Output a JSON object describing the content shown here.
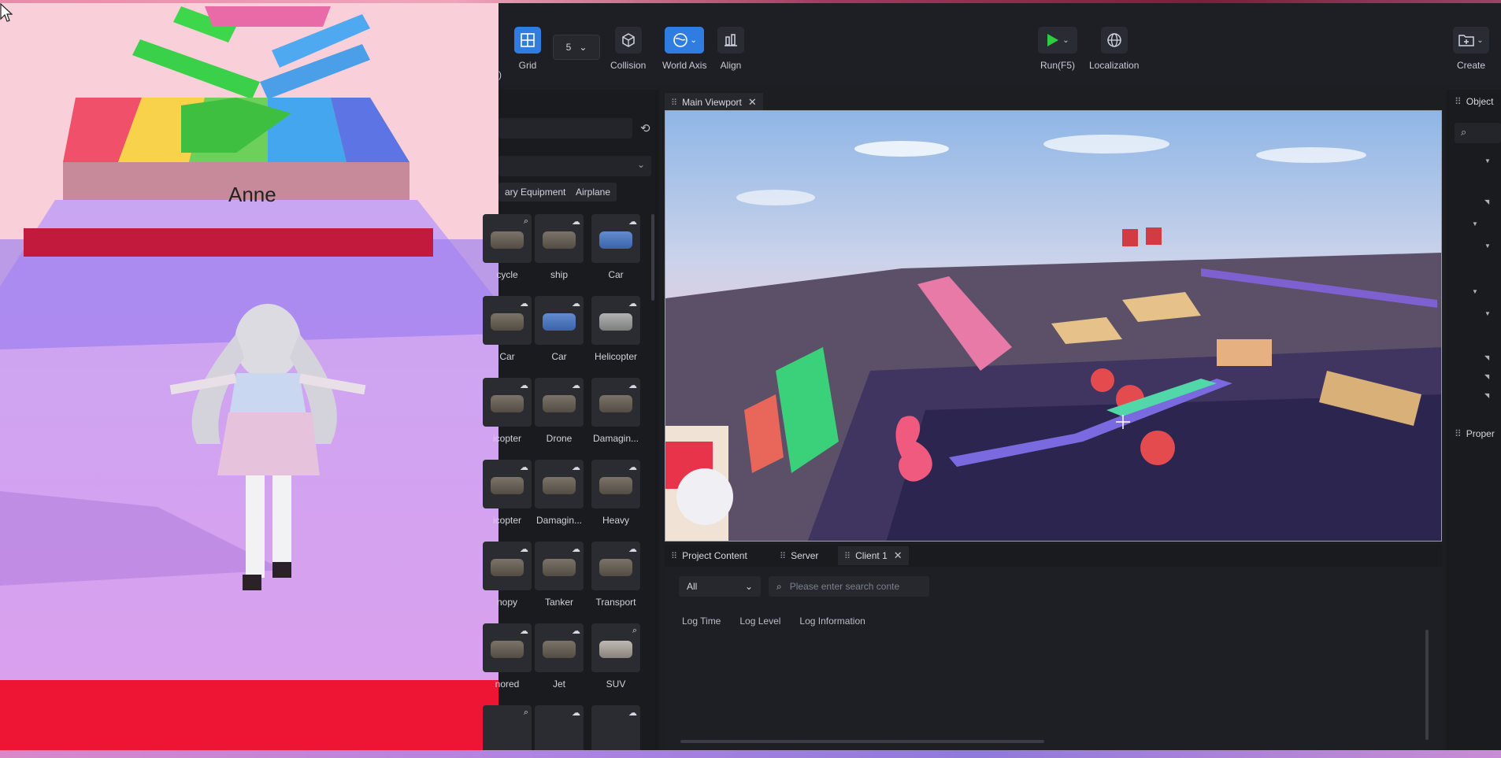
{
  "game": {
    "player_name": "Anne"
  },
  "toolbar": {
    "left_fragment": ")",
    "grid": {
      "label": "Grid"
    },
    "grid_size": {
      "value": "5"
    },
    "collision": {
      "label": "Collision"
    },
    "world_axis": {
      "label": "World Axis"
    },
    "align": {
      "label": "Align"
    },
    "run": {
      "label": "Run(F5)"
    },
    "localization": {
      "label": "Localization"
    },
    "create": {
      "label": "Create"
    }
  },
  "asset_panel": {
    "categories": [
      "ary Equipment",
      "Airplane"
    ],
    "items": [
      {
        "name": "cycle",
        "icon": "bicycle-model-icon"
      },
      {
        "name": "ship",
        "icon": "ship-model-icon"
      },
      {
        "name": "Car",
        "icon": "car-model-icon"
      },
      {
        "name": "Car",
        "icon": "car-model-icon"
      },
      {
        "name": "Car",
        "icon": "car-model-icon"
      },
      {
        "name": "Helicopter",
        "icon": "helicopter-model-icon"
      },
      {
        "name": "icopter",
        "icon": "helicopter-model-icon"
      },
      {
        "name": "Drone",
        "icon": "drone-model-icon"
      },
      {
        "name": "Damagin...",
        "icon": "damaged-vehicle-model-icon"
      },
      {
        "name": "icopter",
        "icon": "helicopter-model-icon"
      },
      {
        "name": "Damagin...",
        "icon": "damaged-vehicle-model-icon"
      },
      {
        "name": "Heavy",
        "icon": "heavy-vehicle-model-icon"
      },
      {
        "name": "nopy",
        "icon": "canopy-model-icon"
      },
      {
        "name": "Tanker",
        "icon": "tanker-model-icon"
      },
      {
        "name": "Transport",
        "icon": "transport-model-icon"
      },
      {
        "name": "nored",
        "icon": "armored-model-icon"
      },
      {
        "name": "Jet",
        "icon": "jet-model-icon"
      },
      {
        "name": "SUV",
        "icon": "suv-model-icon"
      }
    ]
  },
  "viewport": {
    "tab_label": "Main Viewport"
  },
  "right_panel": {
    "objects_title": "Object",
    "properties_title": "Proper"
  },
  "console": {
    "tabs": [
      "Project Content",
      "Server",
      "Client 1"
    ],
    "filter_value": "All",
    "search_placeholder": "Please enter search conte",
    "columns": [
      "Log Time",
      "Log Level",
      "Log Information"
    ]
  },
  "colors": {
    "accent": "#2f7de1",
    "run_green": "#2ecc40",
    "panel_bg": "#1a1b1f"
  }
}
